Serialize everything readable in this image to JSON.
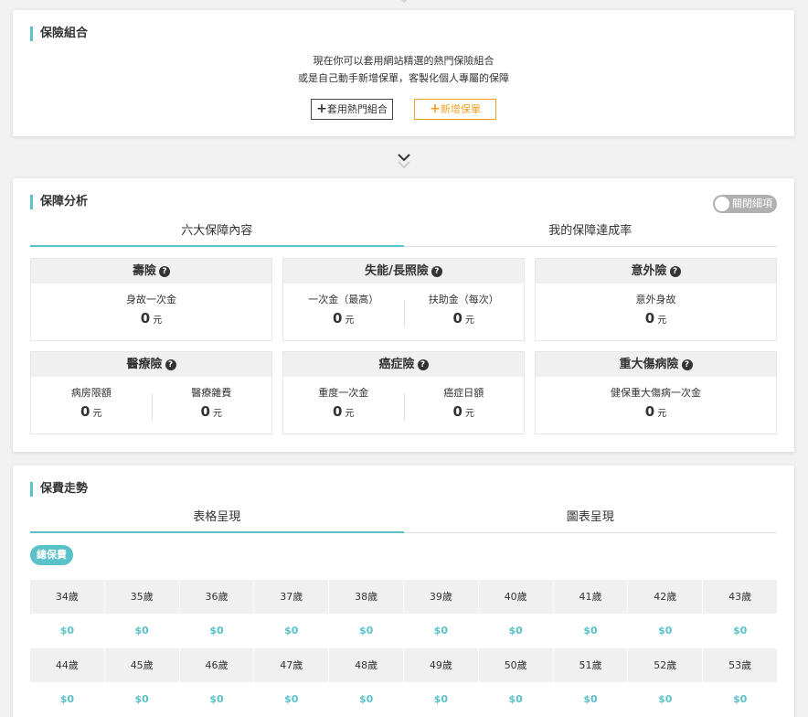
{
  "portfolio": {
    "title": "保險組合",
    "intro_line1": "現在你可以套用網站精選的熱門保險組合",
    "intro_line2": "或是自己動手新增保單，客製化個人專屬的保障",
    "apply_button": "套用熱門組合",
    "new_button": "新增保單"
  },
  "analysis": {
    "title": "保障分析",
    "toggle_label": "關閉細項",
    "tabs": [
      "六大保障內容",
      "我的保障達成率"
    ],
    "boxes": [
      {
        "title": "壽險",
        "metrics": [
          {
            "label": "身故一次金",
            "value": "0",
            "unit": "元"
          }
        ]
      },
      {
        "title": "失能/長照險",
        "metrics": [
          {
            "label": "一次金（最高）",
            "value": "0",
            "unit": "元"
          },
          {
            "label": "扶助金（每次）",
            "value": "0",
            "unit": "元"
          }
        ]
      },
      {
        "title": "意外險",
        "metrics": [
          {
            "label": "意外身故",
            "value": "0",
            "unit": "元"
          }
        ]
      },
      {
        "title": "醫療險",
        "metrics": [
          {
            "label": "病房限額",
            "value": "0",
            "unit": "元"
          },
          {
            "label": "醫療雜費",
            "value": "0",
            "unit": "元"
          }
        ]
      },
      {
        "title": "癌症險",
        "metrics": [
          {
            "label": "重度一次金",
            "value": "0",
            "unit": "元"
          },
          {
            "label": "癌症日額",
            "value": "0",
            "unit": "元"
          }
        ]
      },
      {
        "title": "重大傷病險",
        "metrics": [
          {
            "label": "健保重大傷病一次金",
            "value": "0",
            "unit": "元"
          }
        ]
      }
    ]
  },
  "premium": {
    "title": "保費走勢",
    "tabs": [
      "表格呈現",
      "圖表呈現"
    ],
    "badge": "總保費",
    "rows": [
      {
        "ages": [
          "34歲",
          "35歲",
          "36歲",
          "37歲",
          "38歲",
          "39歲",
          "40歲",
          "41歲",
          "42歲",
          "43歲"
        ],
        "values": [
          "$0",
          "$0",
          "$0",
          "$0",
          "$0",
          "$0",
          "$0",
          "$0",
          "$0",
          "$0"
        ]
      },
      {
        "ages": [
          "44歲",
          "45歲",
          "46歲",
          "47歲",
          "48歲",
          "49歲",
          "50歲",
          "51歲",
          "52歲",
          "53歲"
        ],
        "values": [
          "$0",
          "$0",
          "$0",
          "$0",
          "$0",
          "$0",
          "$0",
          "$0",
          "$0",
          "$0"
        ]
      }
    ]
  },
  "colors": {
    "accent": "#5bc1c8",
    "orange": "#f0a020"
  },
  "icons": [
    "chevron-down-icon",
    "question-icon",
    "plus-icon"
  ]
}
